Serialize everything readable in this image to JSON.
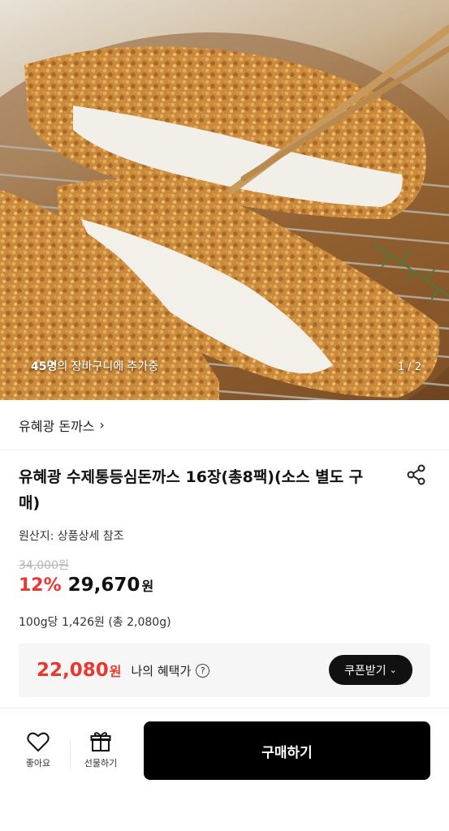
{
  "hero": {
    "cart_count": "45명",
    "cart_suffix": "의 장바구니에 추가중",
    "page_indicator": "1 / 2"
  },
  "brand": {
    "name": "유혜광 돈까스",
    "chevron": "›"
  },
  "product": {
    "title": "유혜광 수제통등심돈까스 16장(총8팩)(소스 별도 구매)",
    "origin": "원산지: 상품상세 참조",
    "original_price": "34,000원",
    "discount": "12%",
    "price": "29,670",
    "currency": "원",
    "unit_price": "100g당 1,426원 (총 2,080g)"
  },
  "benefit": {
    "price": "22,080",
    "currency": "원",
    "label": "나의 혜택가",
    "help_icon_text": "?",
    "coupon_label": "쿠폰받기",
    "coupon_chevron": "⌄"
  },
  "bottom_bar": {
    "like_label": "좋아요",
    "gift_label": "선물하기",
    "buy_label": "구매하기"
  },
  "icons": {
    "share": "share-icon",
    "heart": "heart-icon",
    "gift": "gift-icon",
    "help": "help-icon"
  },
  "colors": {
    "accent_red": "#e8372f",
    "button_dark": "#000000",
    "panel_bg": "#f6f6f6"
  }
}
